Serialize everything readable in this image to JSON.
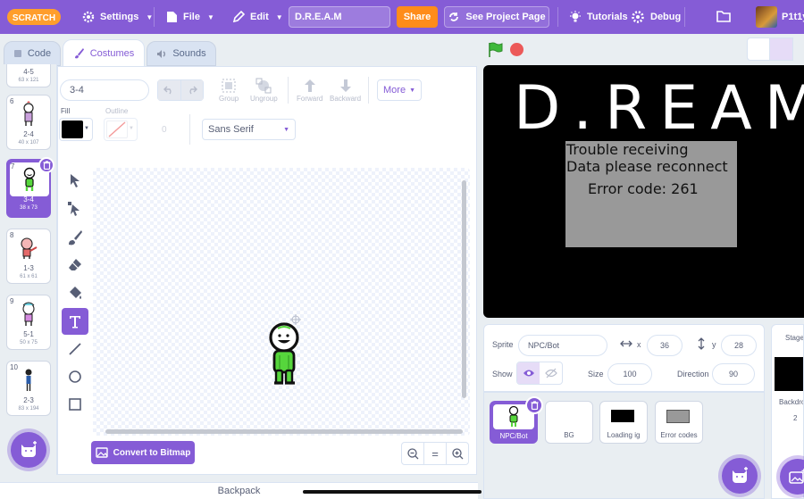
{
  "menubar": {
    "logo": "SCRATCH",
    "settings": "Settings",
    "file": "File",
    "edit": "Edit",
    "project_title": "D.R.E.A.M",
    "share": "Share",
    "see_project_page": "See Project Page",
    "tutorials": "Tutorials",
    "debug": "Debug",
    "username": "P1t1y"
  },
  "tabs": {
    "code": "Code",
    "costumes": "Costumes",
    "sounds": "Sounds"
  },
  "costumes": [
    {
      "num": "",
      "name": "4-5",
      "size": "63 x 121"
    },
    {
      "num": "6",
      "name": "2-4",
      "size": "40 x 107"
    },
    {
      "num": "7",
      "name": "3-4",
      "size": "38 x 73"
    },
    {
      "num": "8",
      "name": "1-3",
      "size": "61 x 61"
    },
    {
      "num": "9",
      "name": "5-1",
      "size": "50 x 75"
    },
    {
      "num": "10",
      "name": "2-3",
      "size": "83 x 194"
    }
  ],
  "paint": {
    "costume_name": "3-4",
    "group": "Group",
    "ungroup": "Ungroup",
    "forward": "Forward",
    "backward": "Backward",
    "more": "More",
    "fill": "Fill",
    "outline": "Outline",
    "outline_width": "0",
    "font": "Sans Serif",
    "convert_bitmap": "Convert to Bitmap",
    "zoom_reset": "="
  },
  "backpack": "Backpack",
  "stage": {
    "title_text": "D.REAM",
    "error_line1": "Trouble receiving",
    "error_line2": "Data please reconnect",
    "error_code": "Error code: 261"
  },
  "sprite_info": {
    "sprite_label": "Sprite",
    "sprite_name": "NPC/Bot",
    "x_label": "x",
    "x_value": "36",
    "y_label": "y",
    "y_value": "28",
    "show_label": "Show",
    "size_label": "Size",
    "size_value": "100",
    "direction_label": "Direction",
    "direction_value": "90"
  },
  "sprites": [
    {
      "name": "NPC/Bot"
    },
    {
      "name": "BG"
    },
    {
      "name": "Loading ig"
    },
    {
      "name": "Error codes"
    }
  ],
  "stage_panel": {
    "label": "Stage",
    "backdrops_label": "Backdro",
    "backdrops_count": "2"
  },
  "colors": {
    "accent": "#855cd6",
    "share": "#ff8c1a",
    "green_flag": "#3fb93c",
    "stop": "#ec5959"
  }
}
